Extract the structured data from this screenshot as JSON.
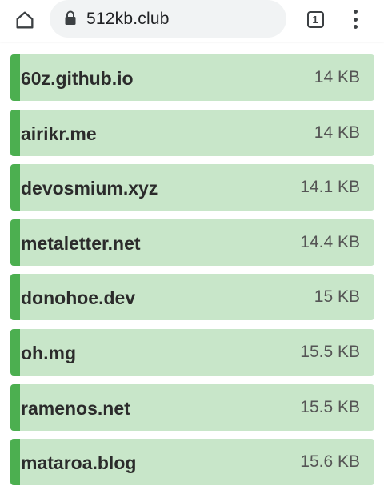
{
  "browser": {
    "url": "512kb.club",
    "tab_count": "1",
    "icons": {
      "home": "home-icon",
      "lock": "lock-icon",
      "tabs": "tab-switcher-icon",
      "menu": "more-vert-icon"
    }
  },
  "colors": {
    "row_background": "#c8e6c9",
    "row_accent": "#4caf50"
  },
  "sites": [
    {
      "name": "60z.github.io",
      "size": "14 KB"
    },
    {
      "name": "airikr.me",
      "size": "14 KB"
    },
    {
      "name": "devosmium.xyz",
      "size": "14.1 KB"
    },
    {
      "name": "metaletter.net",
      "size": "14.4 KB"
    },
    {
      "name": "donohoe.dev",
      "size": "15 KB"
    },
    {
      "name": "oh.mg",
      "size": "15.5 KB"
    },
    {
      "name": "ramenos.net",
      "size": "15.5 KB"
    },
    {
      "name": "mataroa.blog",
      "size": "15.6 KB"
    }
  ]
}
